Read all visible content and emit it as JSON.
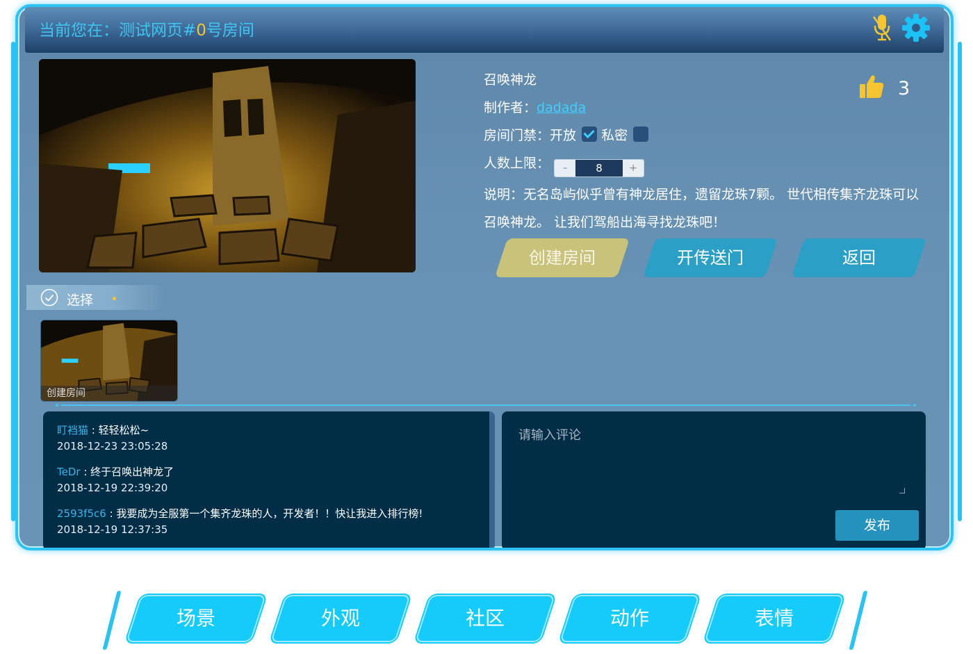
{
  "header": {
    "title_prefix": "当前您在：测试网页#",
    "room_number": "0",
    "title_suffix": "号房间",
    "icons": [
      "mic-muted-icon",
      "gear-icon"
    ]
  },
  "scene": {
    "name": "召唤神龙",
    "maker_label": "制作者：",
    "maker_name": "dadada",
    "access_label": "房间门禁：",
    "open_label": "开放",
    "open_checked": true,
    "private_label": "私密",
    "private_checked": false,
    "limit_label": "人数上限：",
    "limit_value": "8",
    "desc": "说明：无名岛屿似乎曾有神龙居住，遗留龙珠7颗。 世代相传集齐龙珠可以召唤神龙。 让我们驾船出海寻找龙珠吧！",
    "likes": "3"
  },
  "actions": {
    "create": "创建房间",
    "portal": "开传送门",
    "back": "返回"
  },
  "select": {
    "label": "选择",
    "thumb_label": "创建房间"
  },
  "comments": [
    {
      "name": "盯裆猫",
      "sep": " : ",
      "text": "轻轻松松~",
      "time": "2018-12-23 23:05:28"
    },
    {
      "name": "TeDr",
      "sep": " : ",
      "text": "终于召唤出神龙了",
      "time": "2018-12-19 22:39:20"
    },
    {
      "name": "2593f5c6",
      "sep": " : ",
      "text": "我要成为全服第一个集齐龙珠的人，开发者！！快让我进入排行榜!",
      "time": "2018-12-19 12:37:35"
    }
  ],
  "editor": {
    "placeholder": "请输入评论",
    "publish": "发布"
  },
  "nav": [
    "场景",
    "外观",
    "社区",
    "动作",
    "表情"
  ],
  "colors": {
    "accent": "#2cc3f3",
    "nav": "#14cbfb",
    "create_button": "#c8c27a",
    "action_button": "#2b9fc6",
    "comment_bg": "#012d47",
    "room_number": "#f5c531"
  }
}
